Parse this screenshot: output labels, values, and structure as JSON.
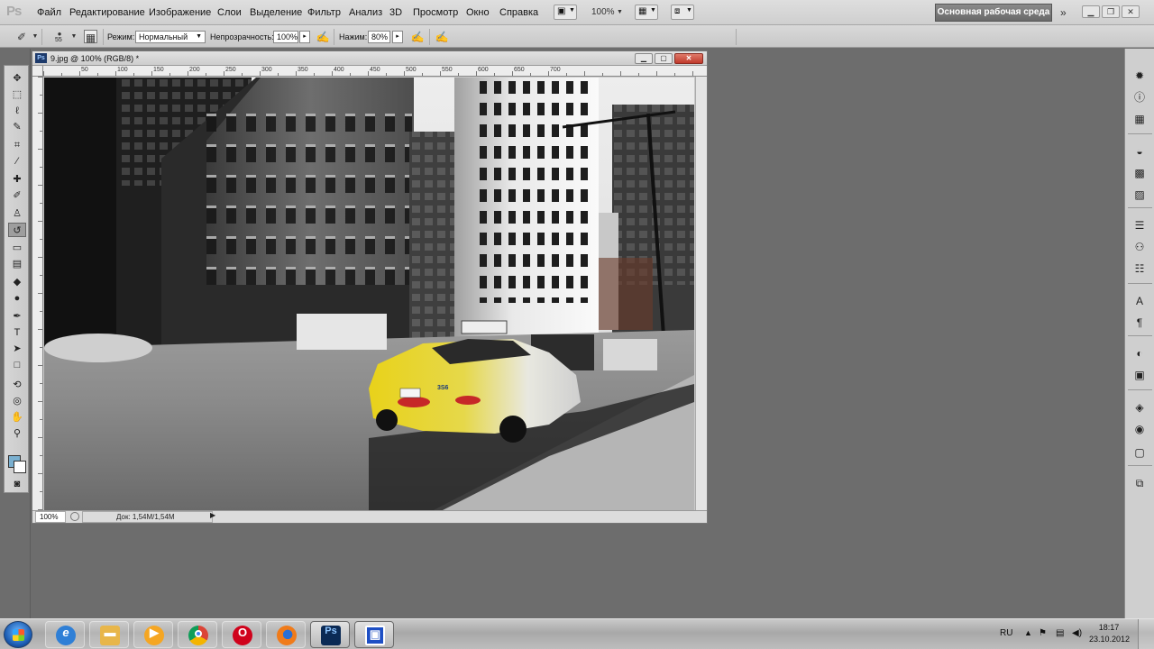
{
  "app": {
    "logo": "Ps",
    "menu": [
      "Файл",
      "Редактирование",
      "Изображение",
      "Слои",
      "Выделение",
      "Фильтр",
      "Анализ",
      "3D",
      "Просмотр",
      "Окно",
      "Справка"
    ],
    "zoom_menu": "100%",
    "workspace": "Основная рабочая среда",
    "overflow": "»"
  },
  "options": {
    "brush_size": "55",
    "mode_label": "Режим:",
    "mode_value": "Нормальный",
    "opacity_label": "Непрозрачность:",
    "opacity_value": "100%",
    "pressure_label": "Нажим:",
    "pressure_value": "80%"
  },
  "tools": [
    {
      "name": "move-tool-icon",
      "glyph": "✥"
    },
    {
      "name": "marquee-tool-icon",
      "glyph": "⬚"
    },
    {
      "name": "lasso-tool-icon",
      "glyph": "ℓ"
    },
    {
      "name": "quick-select-tool-icon",
      "glyph": "✎"
    },
    {
      "name": "crop-tool-icon",
      "glyph": "⌗"
    },
    {
      "name": "eyedropper-tool-icon",
      "glyph": "⁄"
    },
    {
      "name": "spot-healing-tool-icon",
      "glyph": "✚"
    },
    {
      "name": "brush-tool-icon",
      "glyph": "✐"
    },
    {
      "name": "clone-stamp-tool-icon",
      "glyph": "♙"
    },
    {
      "name": "history-brush-tool-icon",
      "glyph": "↺"
    },
    {
      "name": "eraser-tool-icon",
      "glyph": "▭"
    },
    {
      "name": "gradient-tool-icon",
      "glyph": "▤"
    },
    {
      "name": "blur-tool-icon",
      "glyph": "◆"
    },
    {
      "name": "dodge-tool-icon",
      "glyph": "●"
    },
    {
      "name": "pen-tool-icon",
      "glyph": "✒"
    },
    {
      "name": "type-tool-icon",
      "glyph": "T"
    },
    {
      "name": "path-select-tool-icon",
      "glyph": "➤"
    },
    {
      "name": "shape-tool-icon",
      "glyph": "□"
    },
    {
      "name": "3d-rotate-tool-icon",
      "glyph": "⟲"
    },
    {
      "name": "3d-orbit-tool-icon",
      "glyph": "◎"
    },
    {
      "name": "hand-tool-icon",
      "glyph": "✋"
    },
    {
      "name": "zoom-tool-icon",
      "glyph": "⚲"
    },
    {
      "name": "quick-mask-icon",
      "glyph": "◙"
    }
  ],
  "active_tool_index": 9,
  "right_panel": [
    {
      "name": "navigator-panel-icon",
      "glyph": "✹"
    },
    {
      "name": "info-panel-icon",
      "glyph": "ⓘ"
    },
    {
      "name": "histogram-panel-icon",
      "glyph": "▦"
    },
    {
      "name": "color-panel-icon",
      "glyph": "◒"
    },
    {
      "name": "swatches-panel-icon",
      "glyph": "▩"
    },
    {
      "name": "styles-panel-icon",
      "glyph": "▨"
    },
    {
      "name": "adjustments-panel-icon",
      "glyph": "☰"
    },
    {
      "name": "masks-panel-icon",
      "glyph": "⚇"
    },
    {
      "name": "actions-panel-icon",
      "glyph": "☷"
    },
    {
      "name": "character-panel-icon",
      "glyph": "A"
    },
    {
      "name": "paragraph-panel-icon",
      "glyph": "¶"
    },
    {
      "name": "clone-source-panel-icon",
      "glyph": "◐"
    },
    {
      "name": "notes-panel-icon",
      "glyph": "▣"
    },
    {
      "name": "layers-panel-icon",
      "glyph": "◈"
    },
    {
      "name": "channels-panel-icon",
      "glyph": "◉"
    },
    {
      "name": "paths-panel-icon",
      "glyph": "▢"
    },
    {
      "name": "history-panel-icon",
      "glyph": "⧉"
    }
  ],
  "document": {
    "title": "9.jpg @ 100% (RGB/8) *",
    "ruler_labels": [
      "50",
      "100",
      "150",
      "200",
      "250",
      "300",
      "350",
      "400",
      "450",
      "500",
      "550",
      "600",
      "650",
      "700"
    ],
    "zoom": "100%",
    "doc_size": "Док: 1,54M/1,54M",
    "taxi_number": "3S6"
  },
  "taskbar": {
    "language": "RU",
    "time": "18:17",
    "date": "23.10.2012"
  },
  "colors": {
    "foreground": "#7ab0d0",
    "background": "#ffffff",
    "taxi_yellow": "#e8d21a",
    "workspace_bg": "#6d6d6d"
  }
}
